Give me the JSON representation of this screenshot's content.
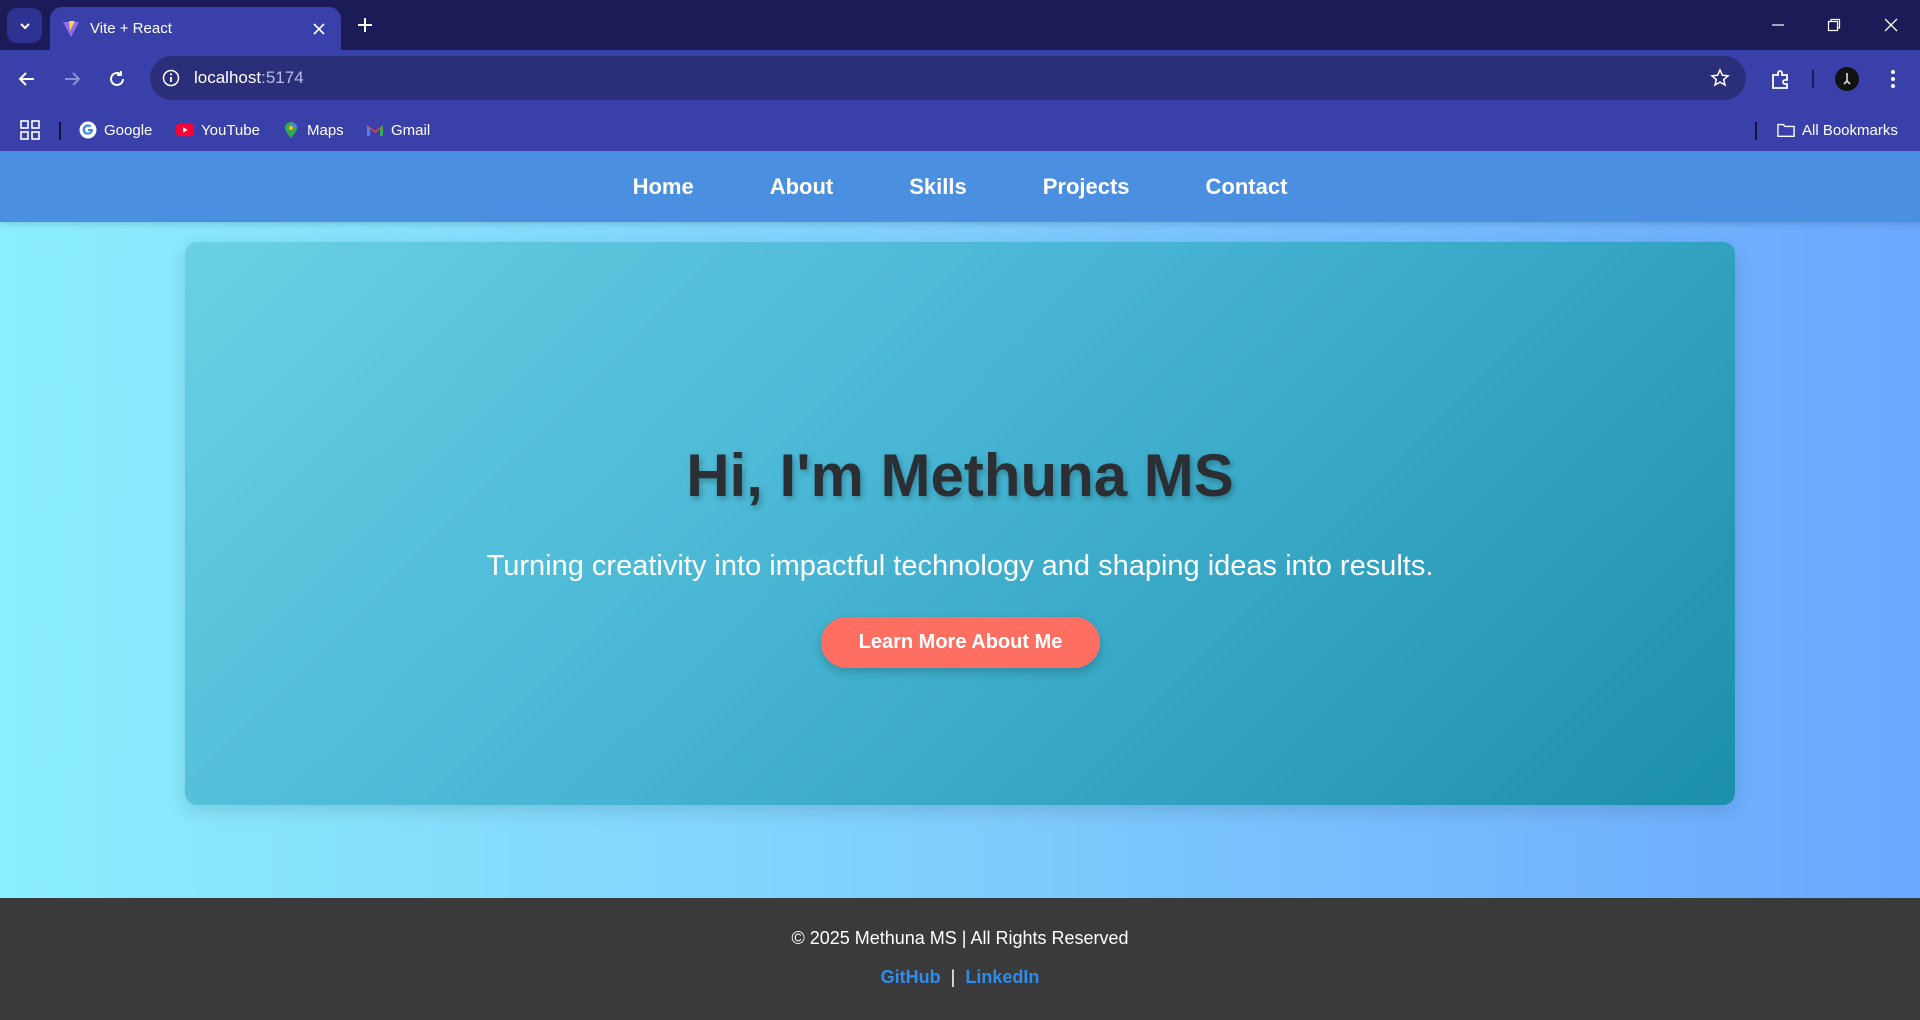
{
  "browser": {
    "tab": {
      "title": "Vite + React"
    },
    "address": {
      "host": "localhost",
      "port": ":5174"
    },
    "bookmarks": [
      {
        "label": "Google",
        "icon": "google-icon"
      },
      {
        "label": "YouTube",
        "icon": "youtube-icon"
      },
      {
        "label": "Maps",
        "icon": "maps-icon"
      },
      {
        "label": "Gmail",
        "icon": "gmail-icon"
      }
    ],
    "all_bookmarks": "All Bookmarks"
  },
  "site": {
    "nav": [
      "Home",
      "About",
      "Skills",
      "Projects",
      "Contact"
    ],
    "hero": {
      "title": "Hi, I'm Methuna MS",
      "subtitle": "Turning creativity into impactful technology and shaping ideas into results.",
      "button": "Learn More About Me"
    },
    "footer": {
      "copyright": "© 2025 Methuna MS | All Rights Reserved",
      "links": [
        "GitHub",
        "LinkedIn"
      ],
      "separator": "|"
    }
  },
  "colors": {
    "accent_button": "#ff6f61",
    "nav_bar": "#4b8fe0",
    "footer_bg": "#3a3a3a",
    "footer_link": "#2d8cf0"
  }
}
